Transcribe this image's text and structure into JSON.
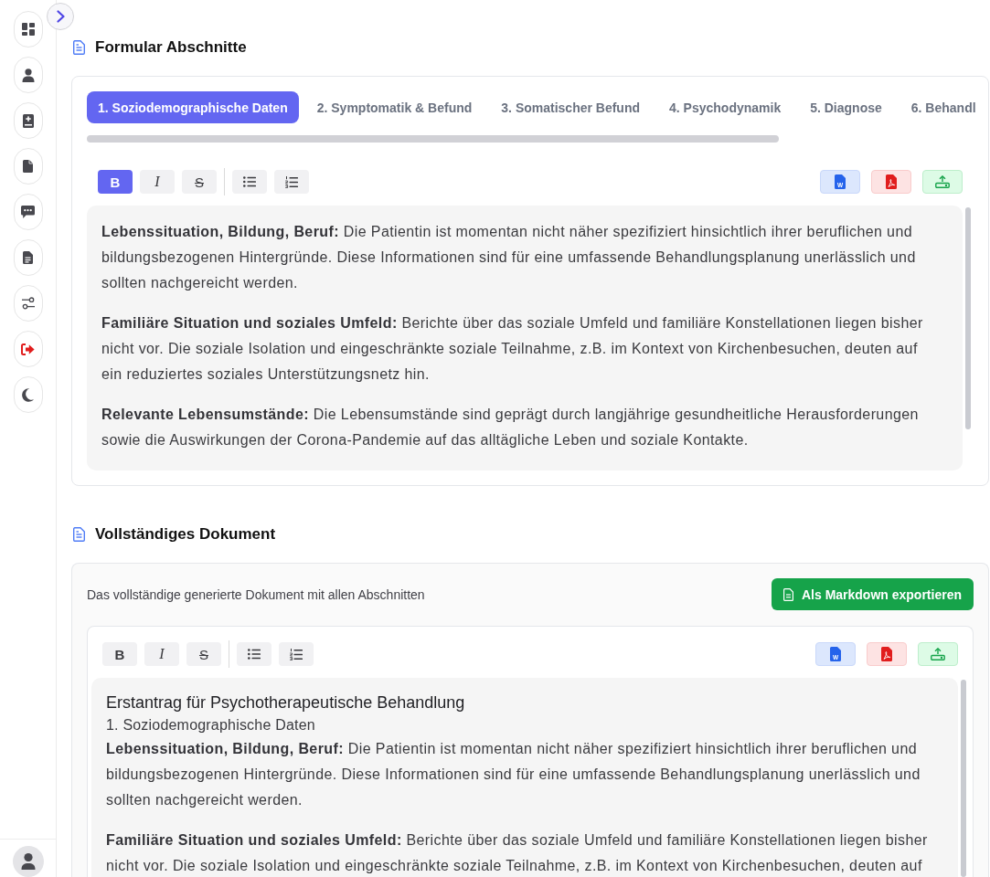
{
  "form_sections": {
    "title": "Formular Abschnitte",
    "tabs": [
      {
        "label": "1. Soziodemographische Daten",
        "selected": true
      },
      {
        "label": "2. Symptomatik & Befund",
        "selected": false
      },
      {
        "label": "3. Somatischer Befund",
        "selected": false
      },
      {
        "label": "4. Psychodynamik",
        "selected": false
      },
      {
        "label": "5. Diagnose",
        "selected": false
      },
      {
        "label": "6. Behandl",
        "selected": false
      }
    ],
    "toolbar": {
      "format_buttons": [
        {
          "kind": "bold",
          "label": "B",
          "active": true
        },
        {
          "kind": "italic",
          "label": "I",
          "active": false
        },
        {
          "kind": "strikethrough",
          "label": "S",
          "active": false
        }
      ],
      "list_buttons": [
        {
          "kind": "bullet_list",
          "active": false
        },
        {
          "kind": "numbered_list",
          "active": false
        }
      ],
      "export_buttons": [
        {
          "kind": "word",
          "letter": "W"
        },
        {
          "kind": "pdf"
        },
        {
          "kind": "upload"
        }
      ]
    },
    "editor": {
      "paragraphs": [
        "**Lebenssituation, Bildung, Beruf:** Die Patientin ist momentan nicht näher spezifiziert hinsichtlich ihrer beruflichen und bildungsbezogenen Hintergründe. Diese Informationen sind für eine umfassende Behandlungsplanung unerlässlich und sollten nachgereicht werden.",
        "**Familiäre Situation und soziales Umfeld:** Berichte über das soziale Umfeld und familiäre Konstellationen liegen bisher nicht vor. Die soziale Isolation und eingeschränkte soziale Teilnahme, z.B. im Kontext von Kirchenbesuchen, deuten auf ein reduziertes soziales Unterstützungsnetz hin.",
        "**Relevante Lebensumstände:** Die Lebensumstände sind geprägt durch langjährige gesundheitliche Herausforderungen sowie die Auswirkungen der Corona-Pandemie auf das alltägliche Leben und soziale Kontakte."
      ]
    }
  },
  "full_document": {
    "title": "Vollständiges Dokument",
    "description": "Das vollständige generierte Dokument mit allen Abschnitten",
    "markdown_button": {
      "label": "Als Markdown exportieren"
    },
    "toolbar": {
      "format_buttons": [
        {
          "kind": "bold",
          "label": "B",
          "active": false
        },
        {
          "kind": "italic",
          "label": "I",
          "active": false
        },
        {
          "kind": "strikethrough",
          "label": "S",
          "active": false
        }
      ],
      "list_buttons": [
        {
          "kind": "bullet_list",
          "active": false
        },
        {
          "kind": "numbered_list",
          "active": false
        }
      ],
      "export_buttons": [
        {
          "kind": "word",
          "letter": "W"
        },
        {
          "kind": "pdf"
        },
        {
          "kind": "upload"
        }
      ]
    },
    "editor": {
      "heading": "Erstantrag für Psychotherapeutische Behandlung",
      "subheading": "1. Soziodemographische Daten",
      "paragraphs": [
        "**Lebenssituation, Bildung, Beruf:** Die Patientin ist momentan nicht näher spezifiziert hinsichtlich ihrer beruflichen und bildungsbezogenen Hintergründe. Diese Informationen sind für eine umfassende Behandlungsplanung unerlässlich und sollten nachgereicht werden.",
        "**Familiäre Situation und soziales Umfeld:** Berichte über das soziale Umfeld und familiäre Konstellationen liegen bisher nicht vor. Die soziale Isolation und eingeschränkte soziale Teilnahme, z.B. im Kontext von Kirchenbesuchen, deuten auf"
      ]
    }
  }
}
